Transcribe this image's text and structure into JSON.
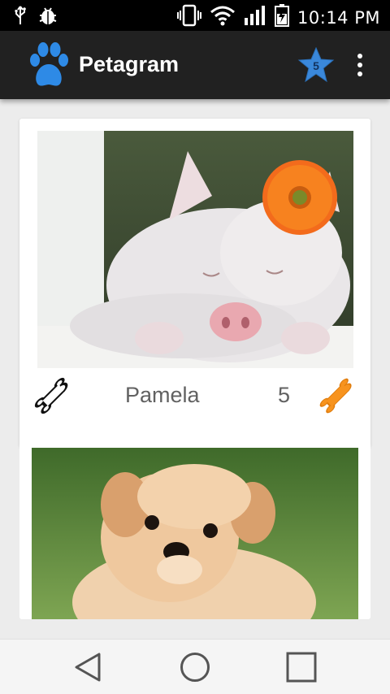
{
  "status_bar": {
    "time": "10:14 PM",
    "icons": [
      "usb-icon",
      "debug-bug-icon",
      "vibrate-icon",
      "wifi-icon",
      "signal-icon",
      "battery-charging-icon"
    ]
  },
  "app_bar": {
    "title": "Petagram",
    "logo_icon": "paw-icon",
    "favorites_count": "5",
    "favorites_icon": "star-icon",
    "menu_icon": "more-vert-icon",
    "colors": {
      "background": "#212121",
      "paw": "#2e8ae6",
      "star": "#3a88db"
    }
  },
  "pets": [
    {
      "name": "Pamela",
      "likes": "5",
      "photo": "pig-with-orange-flower",
      "like_icon": "bone-outline-icon",
      "rating_icon": "bone-filled-icon",
      "rating_color": "#f7931e"
    },
    {
      "photo": "fluffy-puppy"
    }
  ],
  "nav_bar": {
    "icons": [
      "back-triangle-icon",
      "home-circle-icon",
      "recents-square-icon"
    ]
  }
}
